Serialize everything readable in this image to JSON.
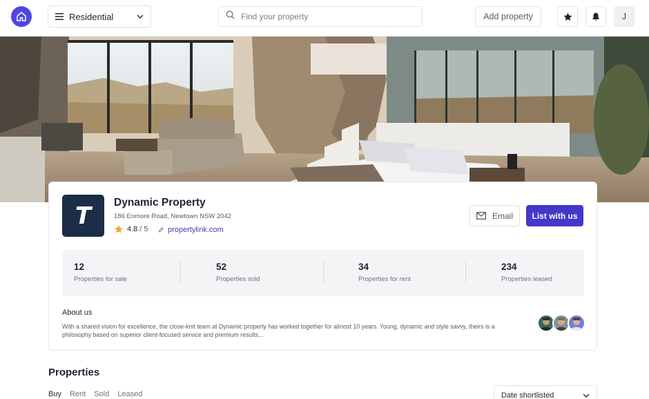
{
  "header": {
    "property_type": "Residential",
    "search_placeholder": "Find your property",
    "add_property_label": "Add property",
    "user_initial": "J"
  },
  "agency": {
    "logo_letter": "T",
    "name": "Dynamic Property",
    "address": "186 Enmore Road, Newtown NSW 2042",
    "rating": "4.8",
    "rating_max": "/ 5",
    "website": "propertylink.com"
  },
  "actions": {
    "email_label": "Email",
    "list_label": "List with us"
  },
  "stats": [
    {
      "value": "12",
      "label": "Properties for sale"
    },
    {
      "value": "52",
      "label": "Properties sold"
    },
    {
      "value": "34",
      "label": "Properties for rent"
    },
    {
      "value": "234",
      "label": "Properties leased"
    }
  ],
  "about": {
    "title": "About us",
    "text": "With a shared vision for excellence, the close-knit team at Dynamic property has worked together for almost 10 years. Young, dynamic and style savvy, theirs is a philosophy based on superior client-focused service and premium results..."
  },
  "properties": {
    "title": "Properties",
    "tabs": [
      "Buy",
      "Rent",
      "Sold",
      "Leased"
    ],
    "sort_label": "Date shortlisted"
  },
  "colors": {
    "accent": "#4338ca",
    "logo_bg": "#1c2d48",
    "star": "#f5a623"
  }
}
